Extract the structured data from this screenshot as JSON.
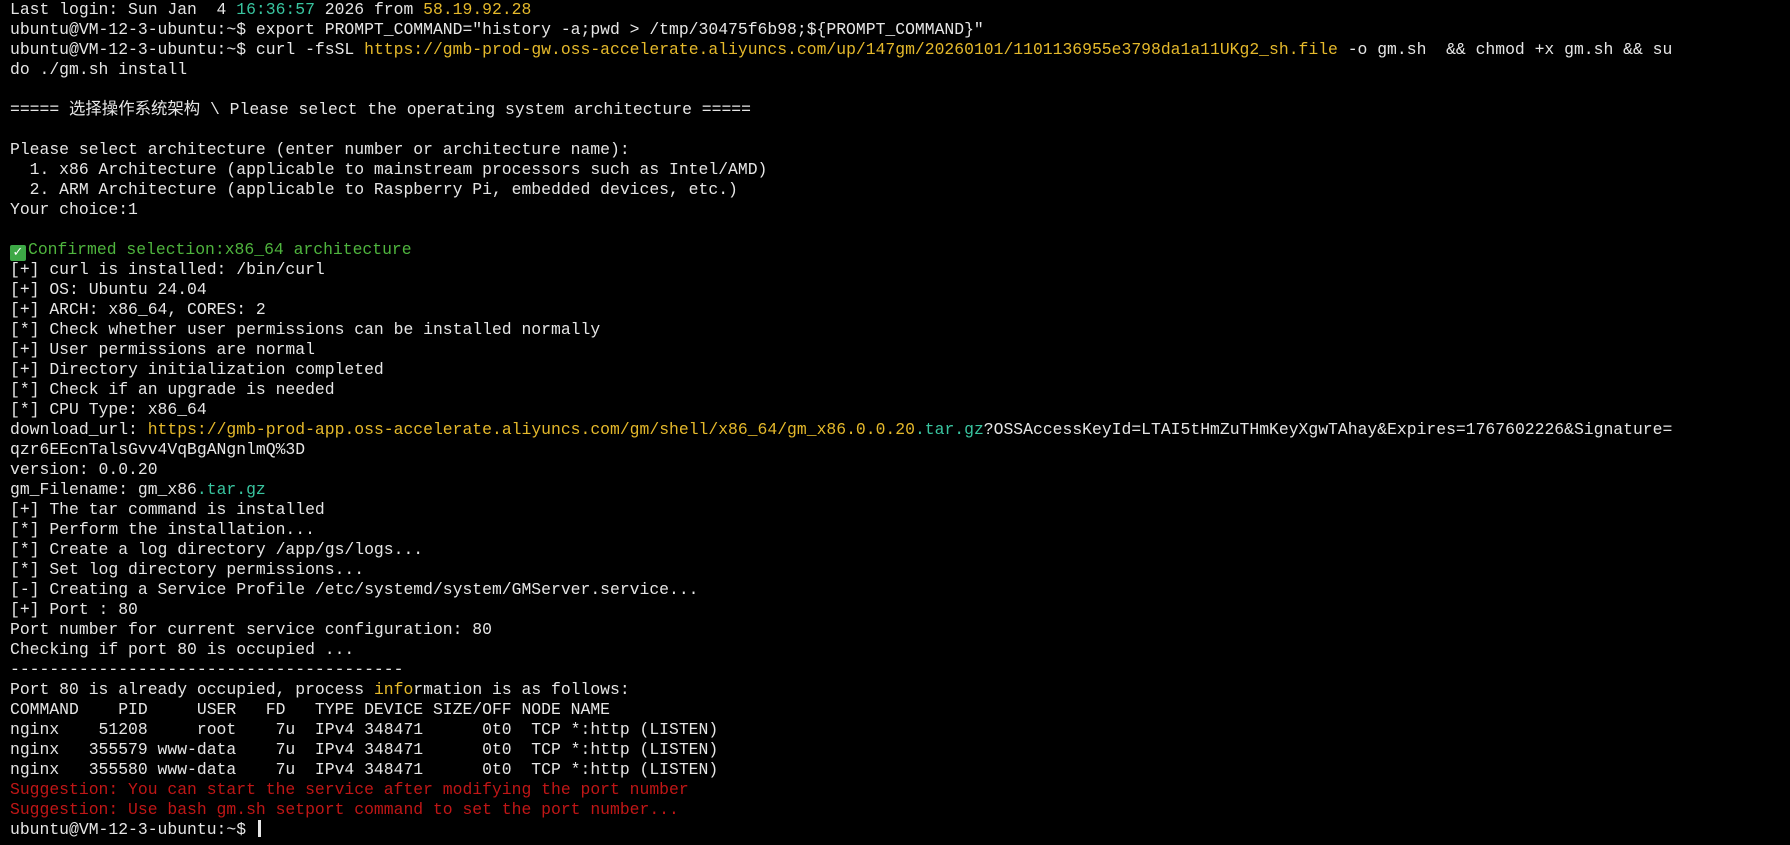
{
  "terminal": {
    "login": {
      "prefix": "Last login: Sun Jan  4 ",
      "time": "16:36:57",
      "mid": " 2026 from ",
      "ip": "58.19.92.28"
    },
    "cmd_export": "ubuntu@VM-12-3-ubuntu:~$ export PROMPT_COMMAND=\"history -a;pwd > /tmp/30475f6b98;${PROMPT_COMMAND}\"",
    "cmd_curl": {
      "prefix": "ubuntu@VM-12-3-ubuntu:~$ curl -fsSL ",
      "url": "https://gmb-prod-gw.oss-accelerate.aliyuncs.com/up/147gm/20260101/1101136955e3798da1a11UKg2_sh.file",
      "suffix": " -o gm.sh  && chmod +x gm.sh && su",
      "wrap": "do ./gm.sh install"
    },
    "arch_header": "===== 选择操作系统架构 \\ Please select the operating system architecture =====",
    "arch_prompt": "Please select architecture (enter number or architecture name):",
    "arch_option_1": "  1. x86 Architecture (applicable to mainstream processors such as Intel/AMD)",
    "arch_option_2": "  2. ARM Architecture (applicable to Raspberry Pi, embedded devices, etc.)",
    "choice": "Your choice:1",
    "check_icon": "white-heavy-check-mark",
    "confirmed": "Confirmed selection:x86_64 architecture",
    "log_a": [
      "[+] curl is installed: /bin/curl",
      "[+] OS: Ubuntu 24.04",
      "[+] ARCH: x86_64, CORES: 2",
      "[*] Check whether user permissions can be installed normally",
      "[+] User permissions are normal",
      "[+] Directory initialization completed",
      "[*] Check if an upgrade is needed",
      "[*] CPU Type: x86_64"
    ],
    "download": {
      "label": "download_url: ",
      "url_start": "https://gmb-prod-app.oss-accelerate.aliyuncs.com/gm/shell/x86_64/gm_x86.0.0.20",
      "url_ext": ".tar.gz",
      "query": "?OSSAccessKeyId=LTAI5tHmZuTHmKeyXgwTAhay&Expires=1767602226&Signature=",
      "wrap": "qzr6EEcnTalsGvv4VqBgANgnlmQ%3D"
    },
    "version": "version: 0.0.20",
    "filename": {
      "label": "gm_Filename: gm_x86",
      "ext": ".tar.gz"
    },
    "log_b": [
      "[+] The tar command is installed",
      "[*] Perform the installation...",
      "[*] Create a log directory /app/gs/logs...",
      "[*] Set log directory permissions...",
      "[-] Creating a Service Profile /etc/systemd/system/GMServer.service...",
      "[+] Port : 80",
      "Port number for current service configuration: 80",
      "Checking if port 80 is occupied ...",
      "----------------------------------------"
    ],
    "port_occupied": {
      "start": "Port 80 is already occupied, process ",
      "hl": "info",
      "end": "rmation is as follows:"
    },
    "lsof_header": "COMMAND    PID     USER   FD   TYPE DEVICE SIZE/OFF NODE NAME",
    "lsof_rows": [
      "nginx    51208     root    7u  IPv4 348471      0t0  TCP *:http (LISTEN)",
      "nginx   355579 www-data    7u  IPv4 348471      0t0  TCP *:http (LISTEN)",
      "nginx   355580 www-data    7u  IPv4 348471      0t0  TCP *:http (LISTEN)"
    ],
    "suggestions": [
      "Suggestion: You can start the service after modifying the port number",
      "Suggestion: Use bash gm.sh setport command to set the port number..."
    ],
    "prompt": "ubuntu@VM-12-3-ubuntu:~$ "
  },
  "colors": {
    "background": "#000000",
    "text": "#e6e6e6",
    "timestamp_green": "#39c5a0",
    "url_yellow": "#e5b92b",
    "success_green": "#4fb53e",
    "error_red": "#c01616"
  }
}
